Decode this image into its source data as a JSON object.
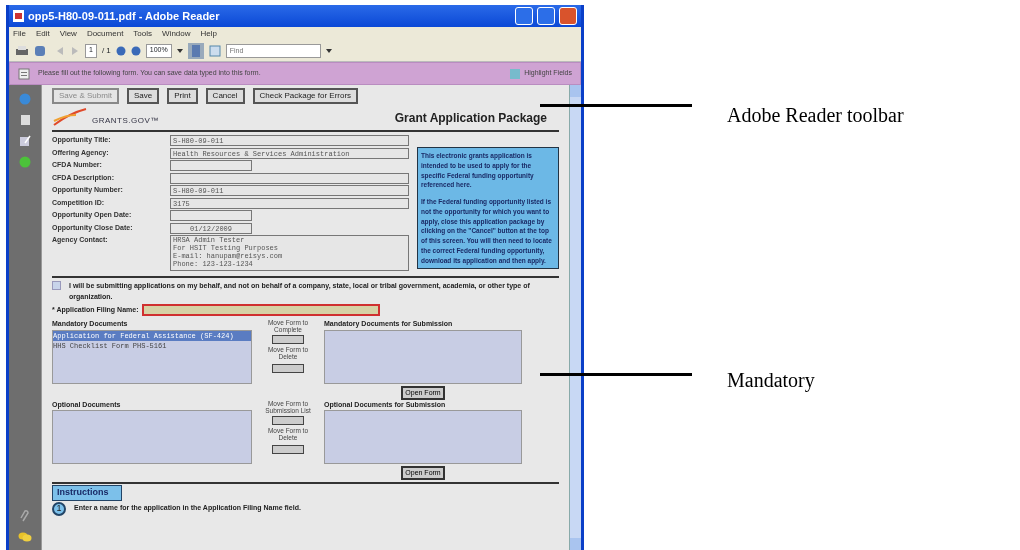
{
  "window": {
    "title": "opp5-H80-09-011.pdf - Adobe Reader"
  },
  "menu": [
    "File",
    "Edit",
    "View",
    "Document",
    "Tools",
    "Window",
    "Help"
  ],
  "toolbar": {
    "page": "1",
    "page_total": "/ 1",
    "zoom": "100%",
    "find_placeholder": "Find"
  },
  "form_bar": {
    "message": "Please fill out the following form. You can save data typed into this form.",
    "button": "Highlight Fields"
  },
  "document": {
    "buttons": [
      {
        "label": "Save & Submit",
        "disabled": true
      },
      {
        "label": "Save",
        "disabled": false
      },
      {
        "label": "Print",
        "disabled": false
      },
      {
        "label": "Cancel",
        "disabled": false
      },
      {
        "label": "Check Package for Errors",
        "disabled": false
      }
    ],
    "logo_text": "GRANTS.GOV",
    "logo_mark": "™",
    "heading": "Grant Application Package",
    "fields": [
      {
        "label": "Opportunity Title:",
        "value": "S-H80-09-011",
        "kind": "long"
      },
      {
        "label": "Offering Agency:",
        "value": "Health Resources & Services Administration",
        "kind": "long"
      },
      {
        "label": "CFDA Number:",
        "kind": "short"
      },
      {
        "label": "CFDA Description:",
        "kind": "long"
      },
      {
        "label": "Opportunity Number:",
        "value": "S-H80-09-011",
        "kind": "long"
      },
      {
        "label": "Competition ID:",
        "value": "3175",
        "kind": "long"
      },
      {
        "label": "Opportunity Open Date:",
        "kind": "short"
      },
      {
        "label": "Opportunity Close Date:",
        "value": "01/12/2009",
        "kind": "short"
      },
      {
        "label": "Agency Contact:",
        "value": "HRSA Admin Tester\nFor HSIT Testing Purposes\nE-mail: hanupam@reisys.com\nPhone: 123-123-1234",
        "kind": "multiline"
      }
    ],
    "info_box": [
      "This electronic grants application is intended to be used to apply for the specific Federal funding opportunity referenced here.",
      "If the Federal funding opportunity listed is not the opportunity for which you want to apply, close this application package by clicking on the \"Cancel\" button at the top of this screen. You will then need to locate the correct Federal funding opportunity, download its application and then apply."
    ],
    "checkbox": {
      "label": "I will be submitting applications on my behalf, and not on behalf of a company, state, local or tribal government, academia, or other type of organization.",
      "checked": false
    },
    "filing_name": {
      "label": "* Application Filing Name:",
      "required": true
    },
    "sections": [
      {
        "left_title": "Mandatory Documents",
        "items": [
          {
            "text": "Application for Federal Assistance (SF-424)",
            "selected": true
          },
          {
            "text": "HHS Checklist Form PHS-5161",
            "selected": false
          }
        ],
        "move_add": "Move Form to Complete",
        "move_remove": "Move Form to Delete",
        "right_title": "Mandatory Documents for Submission",
        "open_button": "Open Form"
      },
      {
        "left_title": "Optional Documents",
        "move_add": "Move Form to Submission List",
        "move_remove": "Move Form to Delete",
        "right_title": "Optional Documents for Submission",
        "open_button": "Open Form"
      }
    ],
    "instructions": {
      "title": "Instructions",
      "step_number": "1",
      "step_text": "Enter a name for the application in the Application Filing Name field."
    }
  },
  "callouts": [
    "Adobe Reader toolbar",
    "Mandatory"
  ]
}
